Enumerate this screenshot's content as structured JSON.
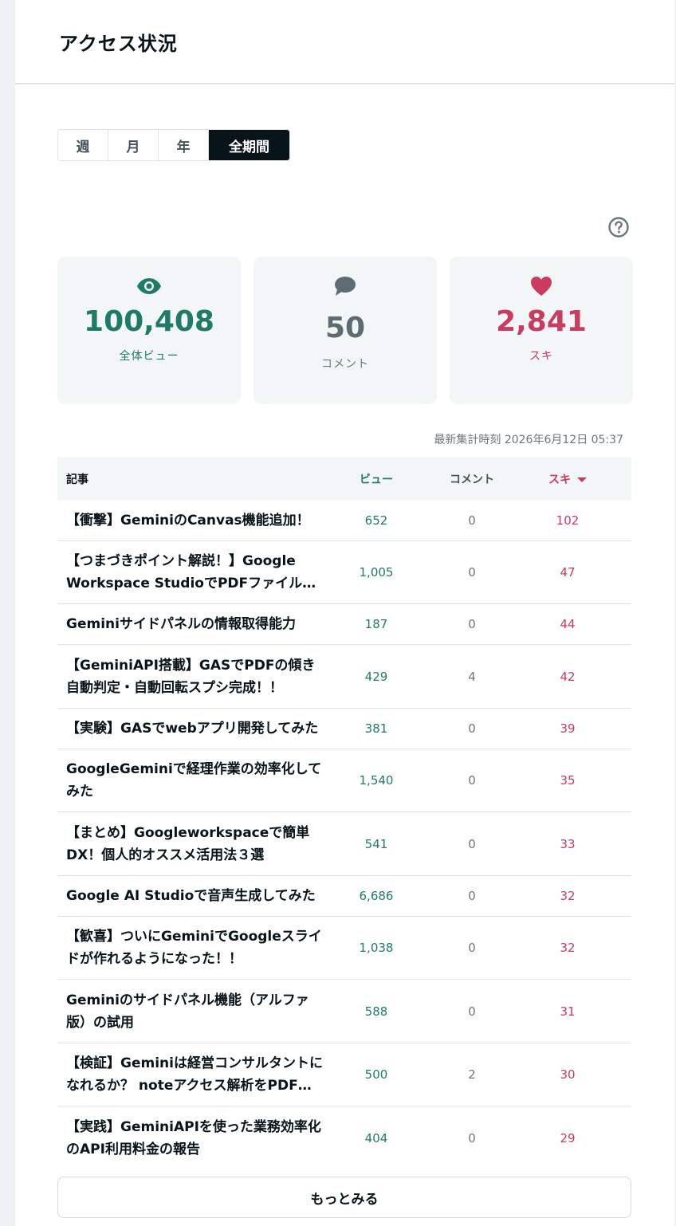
{
  "header": {
    "title": "アクセス状況"
  },
  "tabs": [
    {
      "label": "週",
      "active": false
    },
    {
      "label": "月",
      "active": false
    },
    {
      "label": "年",
      "active": false
    },
    {
      "label": "全期間",
      "active": true
    }
  ],
  "help_icon": "question-circle-icon",
  "stats": {
    "views": {
      "value": "100,408",
      "label": "全体ビュー",
      "icon": "eye-icon",
      "color": "#1f7b68"
    },
    "comments": {
      "value": "50",
      "label": "コメント",
      "icon": "speech-bubble-icon",
      "color": "#5e6b72"
    },
    "likes": {
      "value": "2,841",
      "label": "スキ",
      "icon": "heart-icon",
      "color": "#cb3a5f"
    }
  },
  "updated": "最新集計時刻 2026年6月12日 05:37",
  "table": {
    "headers": {
      "title": "記事",
      "views": "ビュー",
      "comments": "コメント",
      "likes": "スキ"
    },
    "rows": [
      {
        "title": "【衝撃】GeminiのCanvas機能追加！",
        "views": "652",
        "comments": "0",
        "likes": "102"
      },
      {
        "title": "【つまづきポイント解説！】Google Workspace StudioでPDFファイルの要約・…",
        "views": "1,005",
        "comments": "0",
        "likes": "47"
      },
      {
        "title": "Geminiサイドパネルの情報取得能力",
        "views": "187",
        "comments": "0",
        "likes": "44"
      },
      {
        "title": "【GeminiAPI搭載】GASでPDFの傾き自動判定・自動回転スプシ完成！！",
        "views": "429",
        "comments": "4",
        "likes": "42"
      },
      {
        "title": "【実験】GASでwebアプリ開発してみた",
        "views": "381",
        "comments": "0",
        "likes": "39"
      },
      {
        "title": "GoogleGeminiで経理作業の効率化してみた",
        "views": "1,540",
        "comments": "0",
        "likes": "35"
      },
      {
        "title": "【まとめ】Googleworkspaceで簡単DX！個人的オススメ活用法３選",
        "views": "541",
        "comments": "0",
        "likes": "33"
      },
      {
        "title": "Google AI Studioで音声生成してみた",
        "views": "6,686",
        "comments": "0",
        "likes": "32"
      },
      {
        "title": "【歓喜】ついにGeminiでGoogleスライドが作れるようになった！！",
        "views": "1,038",
        "comments": "0",
        "likes": "32"
      },
      {
        "title": "Geminiのサイドパネル機能（アルファ版）の試用",
        "views": "588",
        "comments": "0",
        "likes": "31"
      },
      {
        "title": "【検証】Geminiは経営コンサルタントになれるか？ noteアクセス解析をPDF…",
        "views": "500",
        "comments": "2",
        "likes": "30"
      },
      {
        "title": "【実践】GeminiAPIを使った業務効率化のAPI利用料金の報告",
        "views": "404",
        "comments": "0",
        "likes": "29"
      }
    ]
  },
  "more_button": "もっとみる"
}
